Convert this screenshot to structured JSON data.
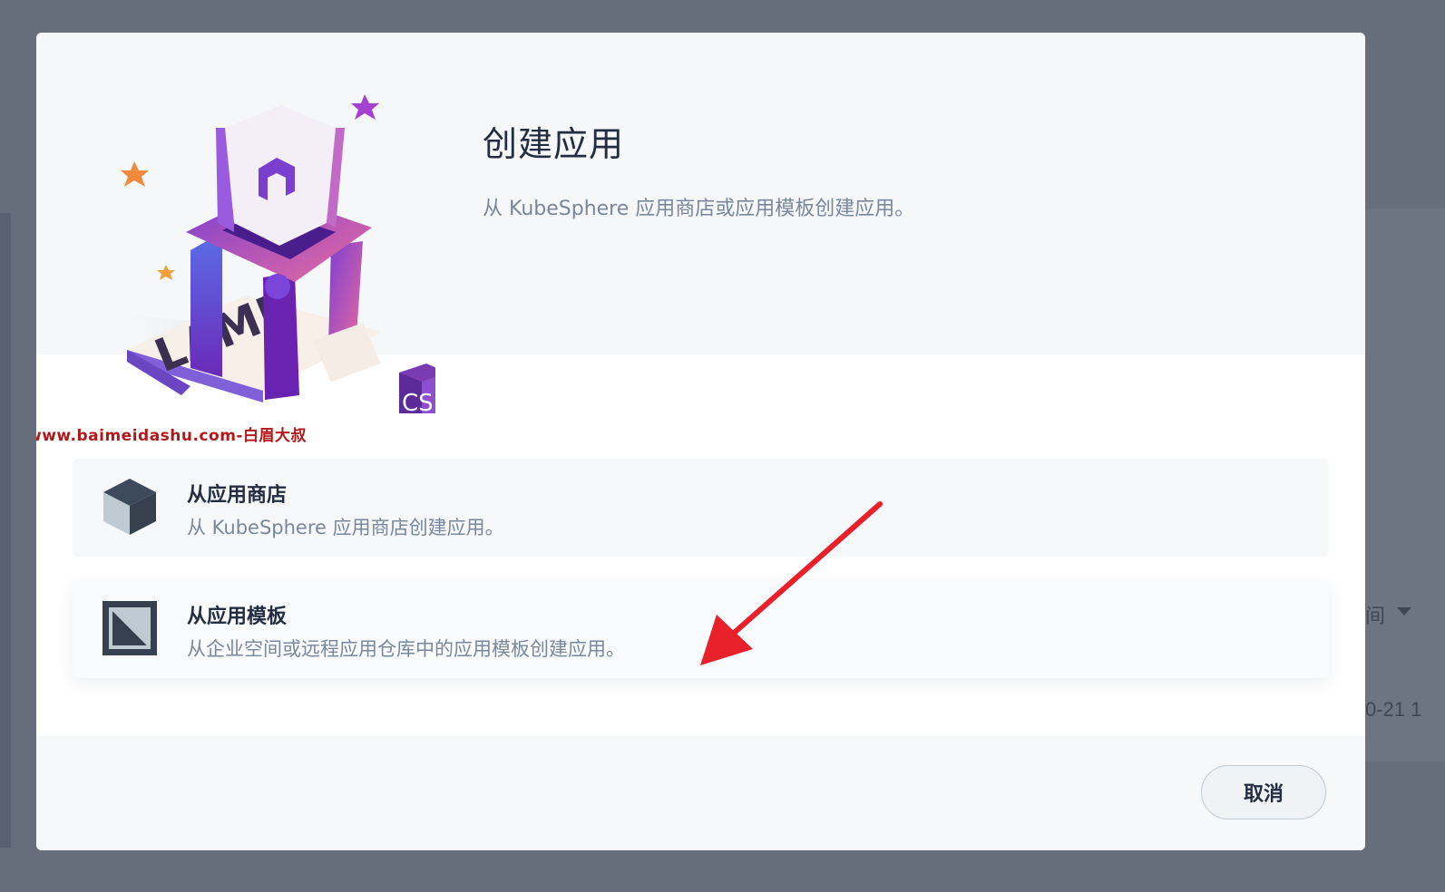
{
  "background": {
    "right_fragment_1": "间",
    "right_fragment_2": "0-21 1"
  },
  "modal": {
    "title": "创建应用",
    "subtitle": "从 KubeSphere 应用商店或应用模板创建应用。",
    "illustration": {
      "letters": "LAMP",
      "cube_letters": "CS"
    },
    "watermark": "www.baimeidashu.com-白眉大叔",
    "options": [
      {
        "title": "从应用商店",
        "description": "从 KubeSphere 应用商店创建应用。",
        "icon": "cube-icon"
      },
      {
        "title": "从应用模板",
        "description": "从企业空间或远程应用仓库中的应用模板创建应用。",
        "icon": "template-icon"
      }
    ],
    "cancel_label": "取消"
  },
  "colors": {
    "overlay": "#666d7b",
    "title": "#242e42",
    "subtitle": "#79879c",
    "arrow": "#e8202a",
    "watermark": "#b3171a"
  }
}
